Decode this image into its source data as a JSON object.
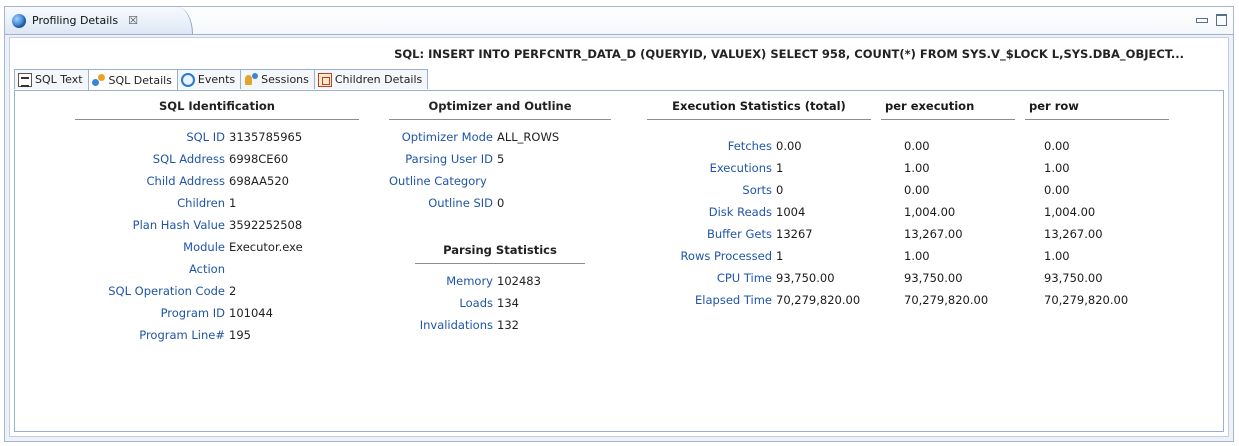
{
  "view": {
    "tab_title": "Profiling Details",
    "close_glyph": "☒",
    "icon": "globe-icon"
  },
  "sql_text": "SQL: INSERT INTO PERFCNTR_DATA_D (QUERYID, VALUEX) SELECT 958, COUNT(*) FROM SYS.V_$LOCK L,SYS.DBA_OBJECT...",
  "tabs": [
    {
      "label": "SQL Text",
      "icon": "sql-text-icon"
    },
    {
      "label": "SQL Details",
      "icon": "sql-details-icon",
      "active": true
    },
    {
      "label": "Events",
      "icon": "events-icon"
    },
    {
      "label": "Sessions",
      "icon": "sessions-icon"
    },
    {
      "label": "Children Details",
      "icon": "children-details-icon"
    }
  ],
  "identification": {
    "title": "SQL Identification",
    "rows": [
      {
        "label": "SQL ID",
        "value": "3135785965"
      },
      {
        "label": "SQL Address",
        "value": "6998CE60"
      },
      {
        "label": "Child Address",
        "value": "698AA520"
      },
      {
        "label": "Children",
        "value": "1"
      },
      {
        "label": "Plan Hash Value",
        "value": "3592252508"
      },
      {
        "label": "Module",
        "value": "Executor.exe"
      },
      {
        "label": "Action",
        "value": ""
      },
      {
        "label": "SQL Operation Code",
        "value": "2"
      },
      {
        "label": "Program ID",
        "value": "101044"
      },
      {
        "label": "Program Line#",
        "value": "195"
      }
    ]
  },
  "optimizer": {
    "title": "Optimizer and Outline",
    "rows": [
      {
        "label": "Optimizer Mode",
        "value": "ALL_ROWS"
      },
      {
        "label": "Parsing User ID",
        "value": "5"
      },
      {
        "label": "Outline Category",
        "value": ""
      },
      {
        "label": "Outline SID",
        "value": "0"
      }
    ]
  },
  "parsing": {
    "title": "Parsing Statistics",
    "rows": [
      {
        "label": "Memory",
        "value": "102483"
      },
      {
        "label": "Loads",
        "value": "134"
      },
      {
        "label": "Invalidations",
        "value": "132"
      }
    ]
  },
  "execution": {
    "headers": [
      "Execution Statistics (total)",
      "per execution",
      "per row"
    ],
    "rows": [
      {
        "label": "Fetches",
        "total": "0.00",
        "per_exec": "0.00",
        "per_row": "0.00"
      },
      {
        "label": "Executions",
        "total": "1",
        "per_exec": "1.00",
        "per_row": "1.00"
      },
      {
        "label": "Sorts",
        "total": "0",
        "per_exec": "0.00",
        "per_row": "0.00"
      },
      {
        "label": "Disk Reads",
        "total": "1004",
        "per_exec": "1,004.00",
        "per_row": "1,004.00"
      },
      {
        "label": "Buffer Gets",
        "total": "13267",
        "per_exec": "13,267.00",
        "per_row": "13,267.00"
      },
      {
        "label": "Rows Processed",
        "total": "1",
        "per_exec": "1.00",
        "per_row": "1.00"
      },
      {
        "label": "CPU Time",
        "total": "93,750.00",
        "per_exec": "93,750.00",
        "per_row": "93,750.00"
      },
      {
        "label": "Elapsed Time",
        "total": "70,279,820.00",
        "per_exec": "70,279,820.00",
        "per_row": "70,279,820.00"
      }
    ]
  }
}
